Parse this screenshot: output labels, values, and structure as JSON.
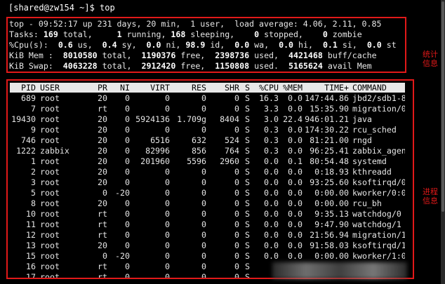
{
  "prompt": "[shared@zw154 ~]$ top",
  "summary": {
    "uptime_line": "top - 09:52:17 up 231 days, 20 min,  1 user,  load average: 4.06, 2.11, 0.85",
    "tasks": {
      "label": "Tasks:",
      "total": "169",
      "total_label": "total,",
      "running": "1",
      "running_label": "running,",
      "sleeping": "168",
      "sleeping_label": "sleeping,",
      "stopped": "0",
      "stopped_label": "stopped,",
      "zombie": "0",
      "zombie_label": "zombie"
    },
    "cpu": {
      "label": "%Cpu(s):",
      "us": "0.6",
      "us_label": "us,",
      "sy": "0.4",
      "sy_label": "sy,",
      "ni": "0.0",
      "ni_label": "ni,",
      "id": "98.9",
      "id_label": "id,",
      "wa": "0.0",
      "wa_label": "wa,",
      "hi": "0.0",
      "hi_label": "hi,",
      "si": "0.1",
      "si_label": "si,",
      "st": "0.0",
      "st_label": "st"
    },
    "mem": {
      "label": "KiB Mem :",
      "total": "8010580",
      "total_label": "total,",
      "free": "1190376",
      "free_label": "free,",
      "used": "2398736",
      "used_label": "used,",
      "buff": "4421468",
      "buff_label": "buff/cache"
    },
    "swap": {
      "label": "KiB Swap:",
      "total": "4063228",
      "total_label": "total,",
      "free": "2912420",
      "free_label": "free,",
      "used": "1150808",
      "used_label": "used.",
      "avail": "5165624",
      "avail_label": "avail Mem"
    }
  },
  "annotations": {
    "stats_label_1": "统计",
    "stats_label_2": "信息",
    "proc_label_1": "进程",
    "proc_label_2": "信息"
  },
  "columns": [
    "PID",
    "USER",
    "PR",
    "NI",
    "VIRT",
    "RES",
    "SHR",
    "S",
    "%CPU",
    "%MEM",
    "TIME+",
    "COMMAND"
  ],
  "processes": [
    [
      "689",
      "root",
      "20",
      "0",
      "0",
      "0",
      "0",
      "S",
      "16.3",
      "0.0",
      "147:44.86",
      "jbd2/sdb1-8"
    ],
    [
      "7",
      "root",
      "rt",
      "0",
      "0",
      "0",
      "0",
      "S",
      "3.3",
      "0.0",
      "15:35.90",
      "migration/0"
    ],
    [
      "19430",
      "root",
      "20",
      "0",
      "5924136",
      "1.709g",
      "8404",
      "S",
      "3.0",
      "22.4",
      "946:01.21",
      "java"
    ],
    [
      "9",
      "root",
      "20",
      "0",
      "0",
      "0",
      "0",
      "S",
      "0.3",
      "0.0",
      "174:30.22",
      "rcu_sched"
    ],
    [
      "746",
      "root",
      "20",
      "0",
      "6516",
      "632",
      "524",
      "S",
      "0.3",
      "0.0",
      "81:21.00",
      "rngd"
    ],
    [
      "1222",
      "zabbix",
      "20",
      "0",
      "82996",
      "856",
      "764",
      "S",
      "0.3",
      "0.0",
      "96:25.41",
      "zabbix_agentd"
    ],
    [
      "1",
      "root",
      "20",
      "0",
      "201960",
      "5596",
      "2960",
      "S",
      "0.0",
      "0.1",
      "80:54.48",
      "systemd"
    ],
    [
      "2",
      "root",
      "20",
      "0",
      "0",
      "0",
      "0",
      "S",
      "0.0",
      "0.0",
      "0:18.93",
      "kthreadd"
    ],
    [
      "3",
      "root",
      "20",
      "0",
      "0",
      "0",
      "0",
      "S",
      "0.0",
      "0.0",
      "93:25.60",
      "ksoftirqd/0"
    ],
    [
      "5",
      "root",
      "0",
      "-20",
      "0",
      "0",
      "0",
      "S",
      "0.0",
      "0.0",
      "0:00.00",
      "kworker/0:0H"
    ],
    [
      "8",
      "root",
      "20",
      "0",
      "0",
      "0",
      "0",
      "S",
      "0.0",
      "0.0",
      "0:00.00",
      "rcu_bh"
    ],
    [
      "10",
      "root",
      "rt",
      "0",
      "0",
      "0",
      "0",
      "S",
      "0.0",
      "0.0",
      "9:35.13",
      "watchdog/0"
    ],
    [
      "11",
      "root",
      "rt",
      "0",
      "0",
      "0",
      "0",
      "S",
      "0.0",
      "0.0",
      "9:47.90",
      "watchdog/1"
    ],
    [
      "12",
      "root",
      "rt",
      "0",
      "0",
      "0",
      "0",
      "S",
      "0.0",
      "0.0",
      "21:56.94",
      "migration/1"
    ],
    [
      "13",
      "root",
      "20",
      "0",
      "0",
      "0",
      "0",
      "S",
      "0.0",
      "0.0",
      "91:58.03",
      "ksoftirqd/1"
    ],
    [
      "15",
      "root",
      "0",
      "-20",
      "0",
      "0",
      "0",
      "S",
      "0.0",
      "0.0",
      "0:00.00",
      "kworker/1:0H"
    ],
    [
      "16",
      "root",
      "rt",
      "0",
      "0",
      "0",
      "0",
      "S",
      "",
      "",
      "",
      ""
    ],
    [
      "17",
      "root",
      "rt",
      "0",
      "0",
      "0",
      "0",
      "S",
      "",
      "",
      "",
      ""
    ]
  ]
}
